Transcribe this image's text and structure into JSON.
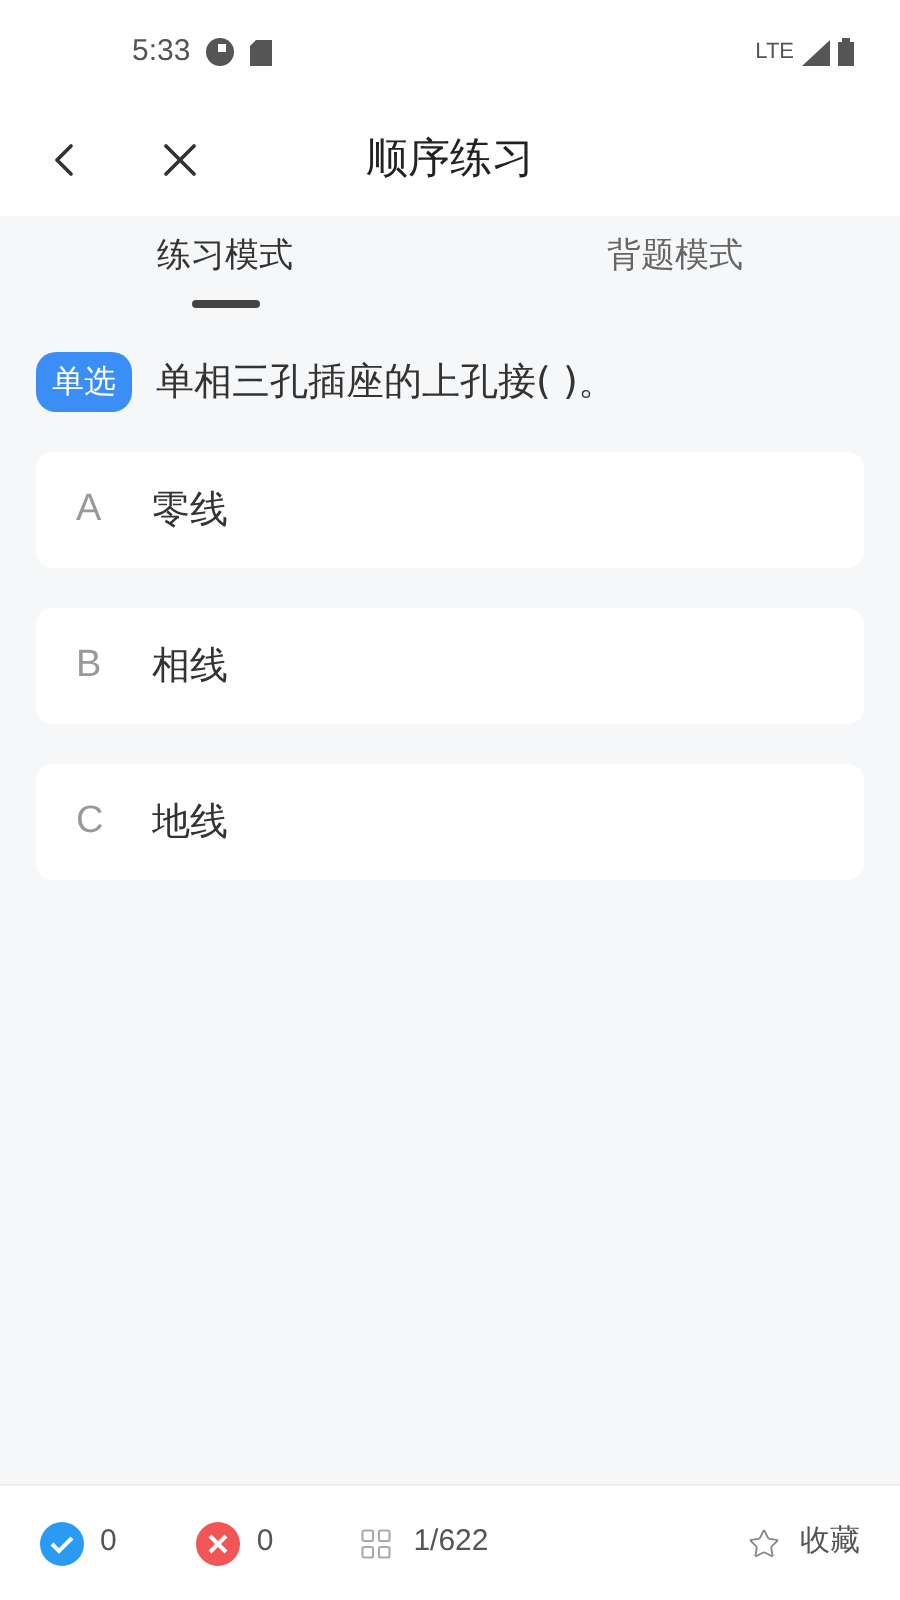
{
  "status_bar": {
    "time": "5:33",
    "network": "LTE"
  },
  "header": {
    "title": "顺序练习"
  },
  "tabs": [
    {
      "label": "练习模式",
      "selected": true
    },
    {
      "label": "背题模式",
      "selected": false
    }
  ],
  "question": {
    "type_badge": "单选",
    "text": "单相三孔插座的上孔接( )。"
  },
  "options": [
    {
      "letter": "A",
      "text": "零线",
      "selected": false
    },
    {
      "letter": "B",
      "text": "相线",
      "selected": false
    },
    {
      "letter": "C",
      "text": "地线",
      "selected": false
    }
  ],
  "bottom_bar": {
    "correct_count": "0",
    "wrong_count": "0",
    "progress": "1/622",
    "favorite_label": "收藏"
  }
}
